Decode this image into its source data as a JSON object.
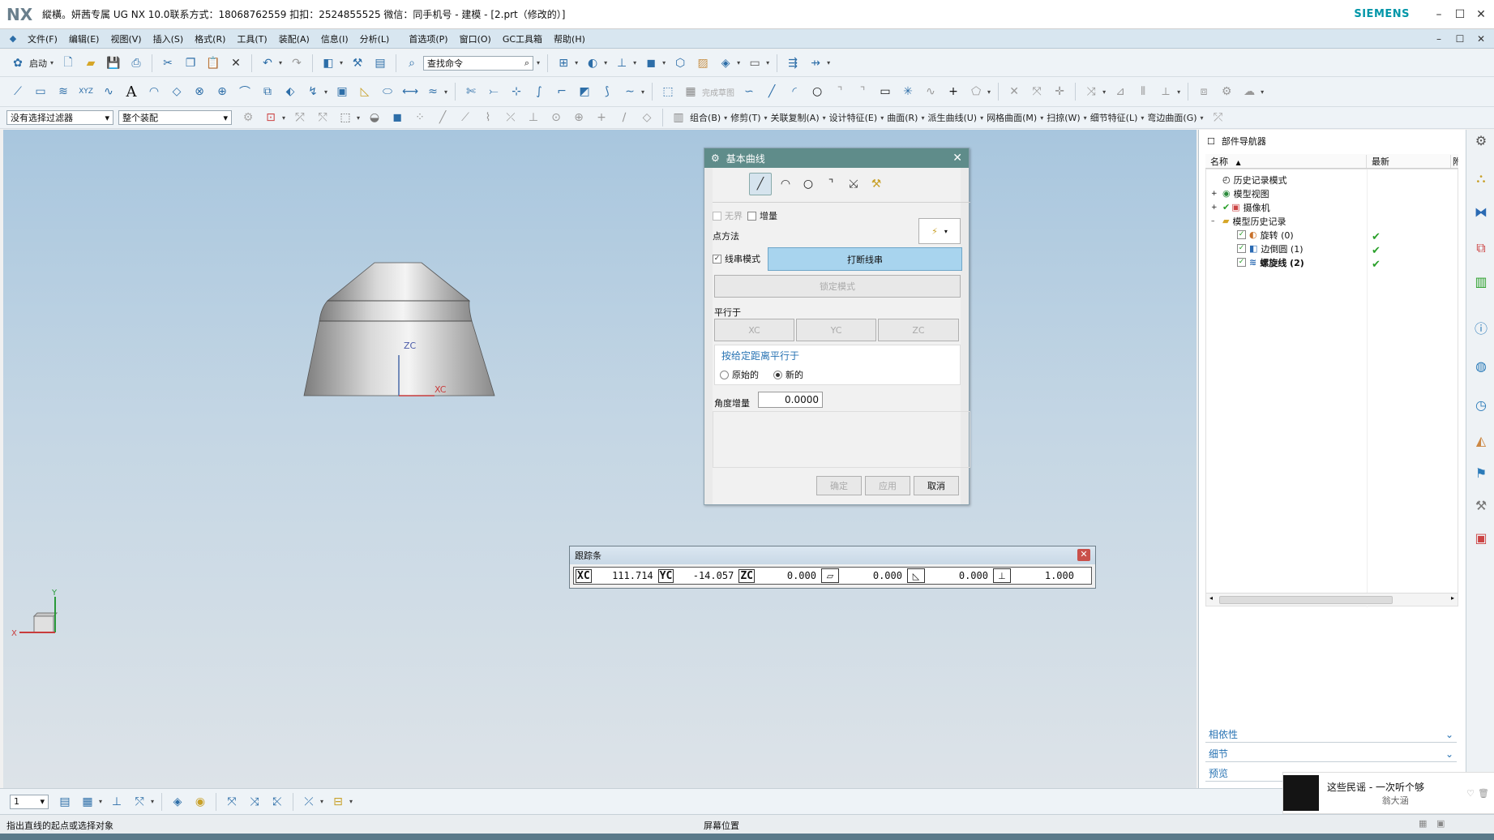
{
  "window": {
    "logo": "NX",
    "title": "縱橫。妍茜专属 UG NX 10.0联系方式：18068762559 扣扣：2524855525 微信：同手机号 - 建模 - [2.prt（修改的）]",
    "brand": "SIEMENS",
    "minimize": "–",
    "maximize": "☐",
    "close": "✕"
  },
  "menu": {
    "items": [
      "文件(F)",
      "编辑(E)",
      "视图(V)",
      "插入(S)",
      "格式(R)",
      "工具(T)",
      "装配(A)",
      "信息(I)",
      "分析(L)",
      "首选项(P)",
      "窗口(O)",
      "GC工具箱",
      "帮助(H)"
    ]
  },
  "toolbar1": {
    "start_label": "启动",
    "search_placeholder": "查找命令"
  },
  "toolbar3": {
    "filter_value": "没有选择过滤器",
    "assembly_value": "整个装配",
    "menus": [
      "组合(B)",
      "修剪(T)",
      "关联复制(A)",
      "设计特征(E)",
      "曲面(R)",
      "派生曲线(U)",
      "网格曲面(M)",
      "扫掠(W)",
      "细节特征(L)",
      "弯边曲面(G)"
    ]
  },
  "viewport": {
    "axis_zc": "ZC",
    "axis_xc": "XC",
    "triad_y": "Y",
    "triad_x": "X"
  },
  "dialog": {
    "title": "基本曲线",
    "unbounded": "无界",
    "increment": "增量",
    "point_method": "点方法",
    "string_mode": "线串模式",
    "break_string": "打断线串",
    "lock_mode": "锁定模式",
    "parallel_to": "平行于",
    "xc": "XC",
    "yc": "YC",
    "zc": "ZC",
    "parallel_dist": "按给定距离平行于",
    "original": "原始的",
    "new": "新的",
    "angle_increment": "角度增量",
    "angle_value": "0.0000",
    "ok": "确定",
    "apply": "应用",
    "cancel": "取消"
  },
  "trackbar": {
    "title": "跟踪条",
    "xc_label": "XC",
    "xc_value": "111.714",
    "yc_label": "YC",
    "yc_value": "-14.057",
    "zc_label": "ZC",
    "zc_value": "0.000",
    "length_value": "0.000",
    "angle_value": "0.000",
    "offset_value": "1.000"
  },
  "navigator": {
    "title": "部件导航器",
    "col_name": "名称",
    "col_latest": "最新",
    "col_extra": "附",
    "items": [
      {
        "label": "历史记录模式",
        "level": 0
      },
      {
        "label": "模型视图",
        "level": 0
      },
      {
        "label": "摄像机",
        "level": 0
      },
      {
        "label": "模型历史记录",
        "level": 0
      },
      {
        "label": "旋转 (0)",
        "level": 1
      },
      {
        "label": "边倒圆 (1)",
        "level": 1
      },
      {
        "label": "螺旋线 (2)",
        "level": 1
      }
    ],
    "acc_dependency": "相依性",
    "acc_detail": "细节",
    "acc_preview": "预览"
  },
  "bottombar": {
    "layer_value": "1"
  },
  "music": {
    "song": "这些民谣 - 一次听个够",
    "artist": "翁大涵"
  },
  "status": {
    "prompt": "指出直线的起点或选择对象",
    "position": "屏幕位置"
  },
  "colors": {
    "dialog_title": "#5f8c8a",
    "break_button": "#a8d4ee",
    "check_green": "#2aa02a",
    "brand": "#0096a8"
  }
}
